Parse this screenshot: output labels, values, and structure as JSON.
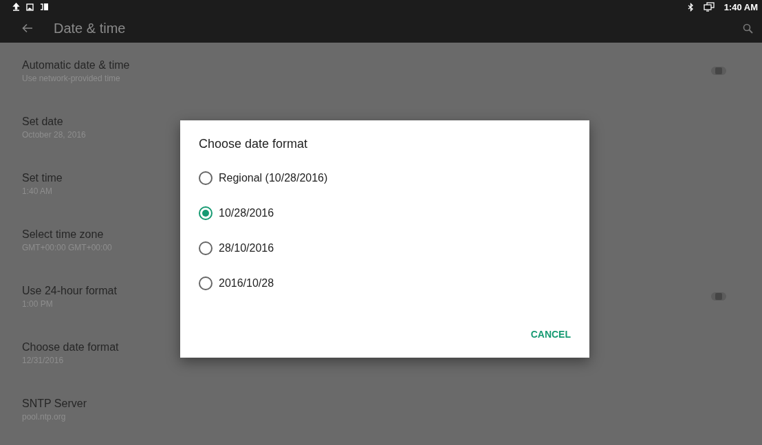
{
  "status_bar": {
    "time": "1:40 AM"
  },
  "app_bar": {
    "title": "Date & time"
  },
  "settings": [
    {
      "kind": "switch",
      "title": "Automatic date & time",
      "summary": "Use network-provided time",
      "on": false
    },
    {
      "kind": "plain",
      "title": "Set date",
      "summary": "October 28, 2016"
    },
    {
      "kind": "plain",
      "title": "Set time",
      "summary": "1:40 AM"
    },
    {
      "kind": "plain",
      "title": "Select time zone",
      "summary": "GMT+00:00 GMT+00:00"
    },
    {
      "kind": "switch",
      "title": "Use 24-hour format",
      "summary": "1:00 PM",
      "on": false
    },
    {
      "kind": "plain",
      "title": "Choose date format",
      "summary": "12/31/2016"
    },
    {
      "kind": "plain",
      "title": "SNTP Server",
      "summary": "pool.ntp.org"
    }
  ],
  "dialog": {
    "title": "Choose date format",
    "options": [
      {
        "label": "Regional (10/28/2016)",
        "selected": false
      },
      {
        "label": "10/28/2016",
        "selected": true
      },
      {
        "label": "28/10/2016",
        "selected": false
      },
      {
        "label": "2016/10/28",
        "selected": false
      }
    ],
    "button": "CANCEL"
  }
}
